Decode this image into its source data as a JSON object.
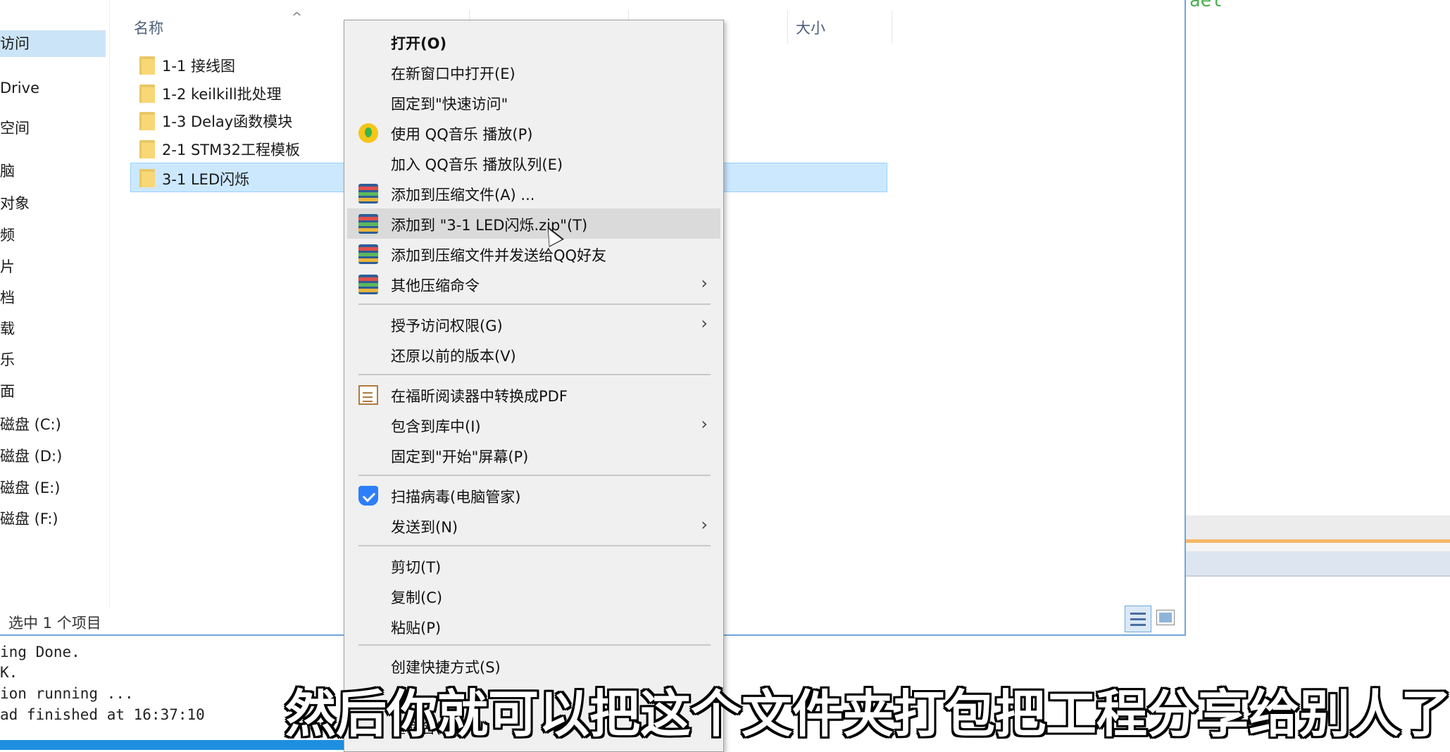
{
  "explorer": {
    "nav_items": [
      {
        "label": "访问",
        "selected": true
      },
      {
        "label": "Drive"
      },
      {
        "label": "空间"
      },
      {
        "label": "脑"
      },
      {
        "label": "对象"
      },
      {
        "label": "频"
      },
      {
        "label": "片"
      },
      {
        "label": "档"
      },
      {
        "label": "载"
      },
      {
        "label": "乐"
      },
      {
        "label": "面"
      },
      {
        "label": "磁盘 (C:)"
      },
      {
        "label": "磁盘 (D:)"
      },
      {
        "label": "磁盘 (E:)"
      },
      {
        "label": "磁盘 (F:)"
      }
    ],
    "columns": {
      "name": "名称",
      "size": "大小"
    },
    "files": [
      {
        "name": "1-1 接线图"
      },
      {
        "name": "1-2 keilkill批处理"
      },
      {
        "name": "1-3 Delay函数模块"
      },
      {
        "name": "2-1 STM32工程模板"
      },
      {
        "name": "3-1 LED闪烁",
        "selected": true
      }
    ],
    "status": "选中 1 个项目"
  },
  "console": {
    "lines": [
      "ing Done.",
      "K.",
      "ion running ...",
      "ad finished at 16:37:10"
    ]
  },
  "context_menu": {
    "items": [
      {
        "label": "打开(O)",
        "bold": true
      },
      {
        "label": "在新窗口中打开(E)"
      },
      {
        "label": "固定到\"快速访问\""
      },
      {
        "label": "使用 QQ音乐 播放(P)",
        "icon": "qq-music-icon"
      },
      {
        "label": "加入 QQ音乐 播放队列(E)"
      },
      {
        "label": "添加到压缩文件(A) ...",
        "icon": "winrar-icon"
      },
      {
        "label": "添加到 \"3-1 LED闪烁.zip\"(T)",
        "icon": "winrar-icon",
        "hover": true
      },
      {
        "label": "添加到压缩文件并发送给QQ好友",
        "icon": "winrar-icon"
      },
      {
        "label": "其他压缩命令",
        "icon": "winrar-icon",
        "submenu": true
      },
      {
        "label": "授予访问权限(G)",
        "submenu": true
      },
      {
        "label": "还原以前的版本(V)"
      },
      {
        "label": "在福昕阅读器中转换成PDF",
        "icon": "foxit-pdf-icon"
      },
      {
        "label": "包含到库中(I)",
        "submenu": true
      },
      {
        "label": "固定到\"开始\"屏幕(P)"
      },
      {
        "label": "扫描病毒(电脑管家)",
        "icon": "shield-icon"
      },
      {
        "label": "发送到(N)",
        "submenu": true
      },
      {
        "label": "剪切(T)"
      },
      {
        "label": "复制(C)"
      },
      {
        "label": "粘贴(P)"
      },
      {
        "label": "创建快捷方式(S)"
      },
      {
        "label": "重命名(M)"
      }
    ]
  },
  "subtitle": "然后你就可以把这个文件夹打包把工程分享给别人了"
}
